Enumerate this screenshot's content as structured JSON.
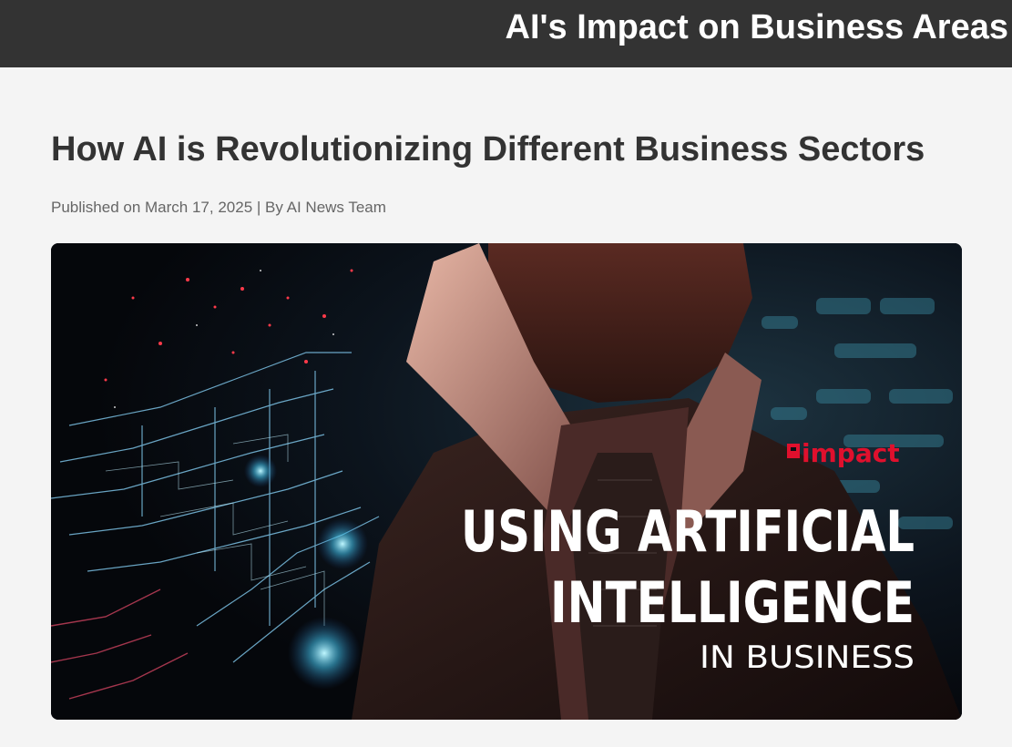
{
  "header": {
    "title": "AI's Impact on Business Areas"
  },
  "article": {
    "title": "How AI is Revolutionizing Different Business Sectors",
    "meta": "Published on March 17, 2025 | By AI News Team",
    "hero": {
      "brand": "impact",
      "headline_line1": "USING ARTIFICIAL",
      "headline_line2": "INTELLIGENCE",
      "headline_line3": "IN BUSINESS"
    }
  },
  "colors": {
    "header_bg": "#333333",
    "page_bg": "#f4f4f4",
    "title_text": "#333333",
    "meta_text": "#666666",
    "brand_red": "#e0102d"
  }
}
